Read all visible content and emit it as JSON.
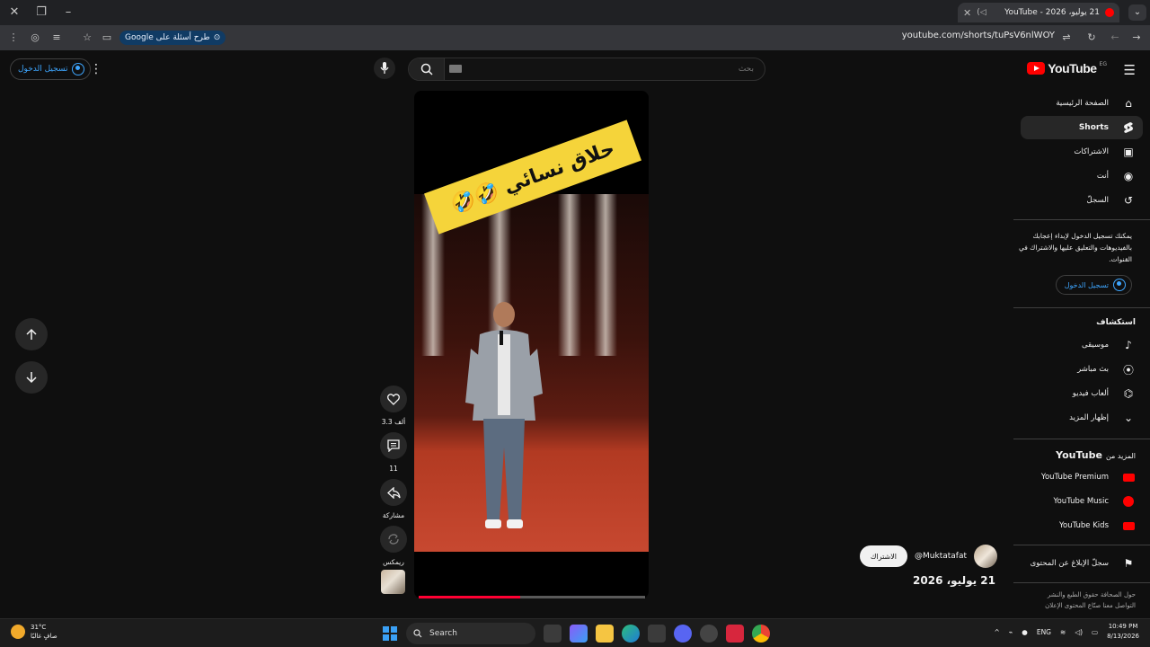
{
  "browser": {
    "tab_title": "21 يوليو، 2026 - YouTube",
    "url": "youtube.com/shorts/tuPsV6nlWOY",
    "gemini_label": "طرح أسئلة على Google"
  },
  "header": {
    "signin_label": "تسجيل الدخول",
    "search_placeholder": "بحث",
    "logo_text": "YouTube",
    "logo_country": "EG"
  },
  "sidebar": {
    "items": [
      {
        "label": "الصفحة الرئيسية",
        "icon": "home-icon"
      },
      {
        "label": "Shorts",
        "icon": "shorts-icon"
      },
      {
        "label": "الاشتراكات",
        "icon": "subscriptions-icon"
      },
      {
        "label": "أنت",
        "icon": "you-icon"
      },
      {
        "label": "السجلّ",
        "icon": "history-icon"
      }
    ],
    "signin_message": "يمكنك تسجيل الدخول لإبداء إعجابك بالفيديوهات والتعليق عليها والاشتراك في القنوات.",
    "signin_button": "تسجيل الدخول",
    "explore_title": "استكشاف",
    "explore_items": [
      {
        "label": "موسيقى",
        "icon": "music-icon"
      },
      {
        "label": "بث مباشر",
        "icon": "live-icon"
      },
      {
        "label": "ألعاب فيديو",
        "icon": "gaming-icon"
      },
      {
        "label": "إظهار المزيد",
        "icon": "chevron-down-icon"
      }
    ],
    "more_title_prefix": "المزيد من",
    "more_title_brand": "YouTube",
    "more_items": [
      {
        "label": "YouTube Premium"
      },
      {
        "label": "YouTube Music"
      },
      {
        "label": "YouTube Kids"
      }
    ],
    "report_label": "سجلّ الإبلاغ عن المحتوى",
    "footer_line1": "حول  الصحافة  حقوق الطبع والنشر",
    "footer_line2": "التواصل معنا  صنّاع المحتوى  الإعلان"
  },
  "video": {
    "caption": "حلاق نسائي 🤣🤣",
    "progress": 0.45
  },
  "actions": {
    "likes": "3.3 ألف",
    "comments": "11",
    "share": "مشاركة",
    "remix": "ريمكس"
  },
  "channel": {
    "handle": "@Muktatafat",
    "subscribe": "الاشتراك",
    "date": "21 يوليو، 2026"
  },
  "taskbar": {
    "temperature": "31°C",
    "weather_desc": "صافٍ غالبًا",
    "search_label": "Search",
    "language": "ENG",
    "time": "10:49 PM",
    "date": "8/13/2026"
  },
  "colors": {
    "background": "#0f0f0f",
    "accent_blue": "#3ea6ff",
    "youtube_red": "#ff0000",
    "caption_yellow": "#f5d43a"
  }
}
